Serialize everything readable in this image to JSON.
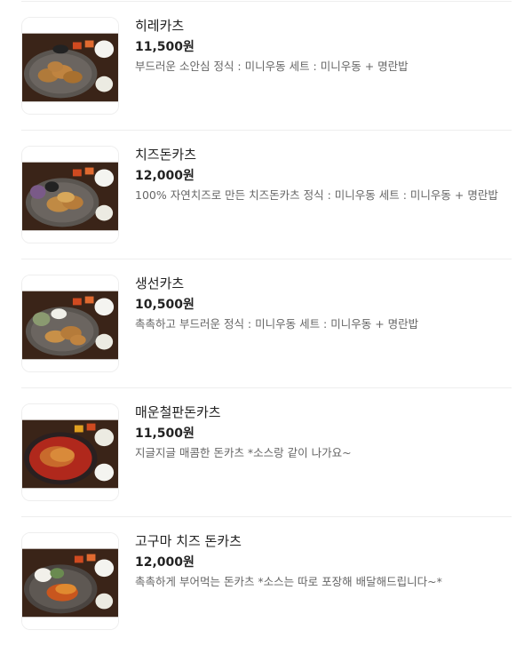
{
  "menu": {
    "items": [
      {
        "name": "히레카츠",
        "price": "11,500원",
        "description": "부드러운 소안심 정식 : 미니우동 세트 : 미니우동 + 명란밥",
        "image": "hire-katsu-plate-photo"
      },
      {
        "name": "치즈돈카츠",
        "price": "12,000원",
        "description": "100% 자연치즈로 만든 치즈돈카츠 정식 : 미니우동 세트 : 미니우동 + 명란밥",
        "image": "cheese-donkatsu-plate-photo"
      },
      {
        "name": "생선카츠",
        "price": "10,500원",
        "description": "촉촉하고 부드러운 정식 : 미니우동 세트 : 미니우동 + 명란밥",
        "image": "fish-katsu-plate-photo"
      },
      {
        "name": "매운철판돈카츠",
        "price": "11,500원",
        "description": "지글지글 매콤한 돈카츠 *소스랑 같이 나가요~",
        "image": "spicy-iron-plate-donkatsu-photo"
      },
      {
        "name": "고구마 치즈 돈카츠",
        "price": "12,000원",
        "description": "촉촉하게 부어먹는 돈카츠 *소스는 따로 포장해 배달해드립니다~*",
        "image": "sweet-potato-cheese-donkatsu-photo"
      }
    ]
  }
}
